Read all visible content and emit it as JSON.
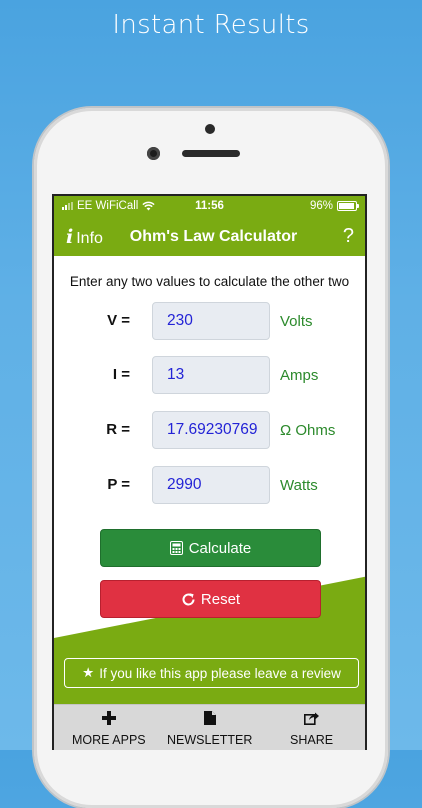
{
  "promo": {
    "title": "Instant Results"
  },
  "status": {
    "carrier": "EE WiFiCall",
    "time": "11:56",
    "battery": "96%"
  },
  "nav": {
    "info_label": "Info",
    "title": "Ohm's Law Calculator",
    "help": "?"
  },
  "instructions": "Enter any two values to calculate the other two",
  "inputs": [
    {
      "label": "V =",
      "value": "230",
      "unit": "Volts"
    },
    {
      "label": "I =",
      "value": "13",
      "unit": "Amps"
    },
    {
      "label": "R =",
      "value": "17.69230769",
      "unit": "Ω Ohms"
    },
    {
      "label": "P =",
      "value": "2990",
      "unit": "Watts"
    }
  ],
  "buttons": {
    "calculate": "Calculate",
    "reset": "Reset"
  },
  "review": {
    "text": "If you like this app please leave a review"
  },
  "tabs": [
    {
      "label": "MORE APPS",
      "icon": "plus-icon"
    },
    {
      "label": "NEWSLETTER",
      "icon": "document-icon"
    },
    {
      "label": "SHARE",
      "icon": "share-icon"
    }
  ],
  "colors": {
    "header_green": "#7aab12",
    "calculate_green": "#2a8c3a",
    "reset_red": "#e03142",
    "value_blue": "#2323d6",
    "unit_green": "#2c8a2c"
  }
}
